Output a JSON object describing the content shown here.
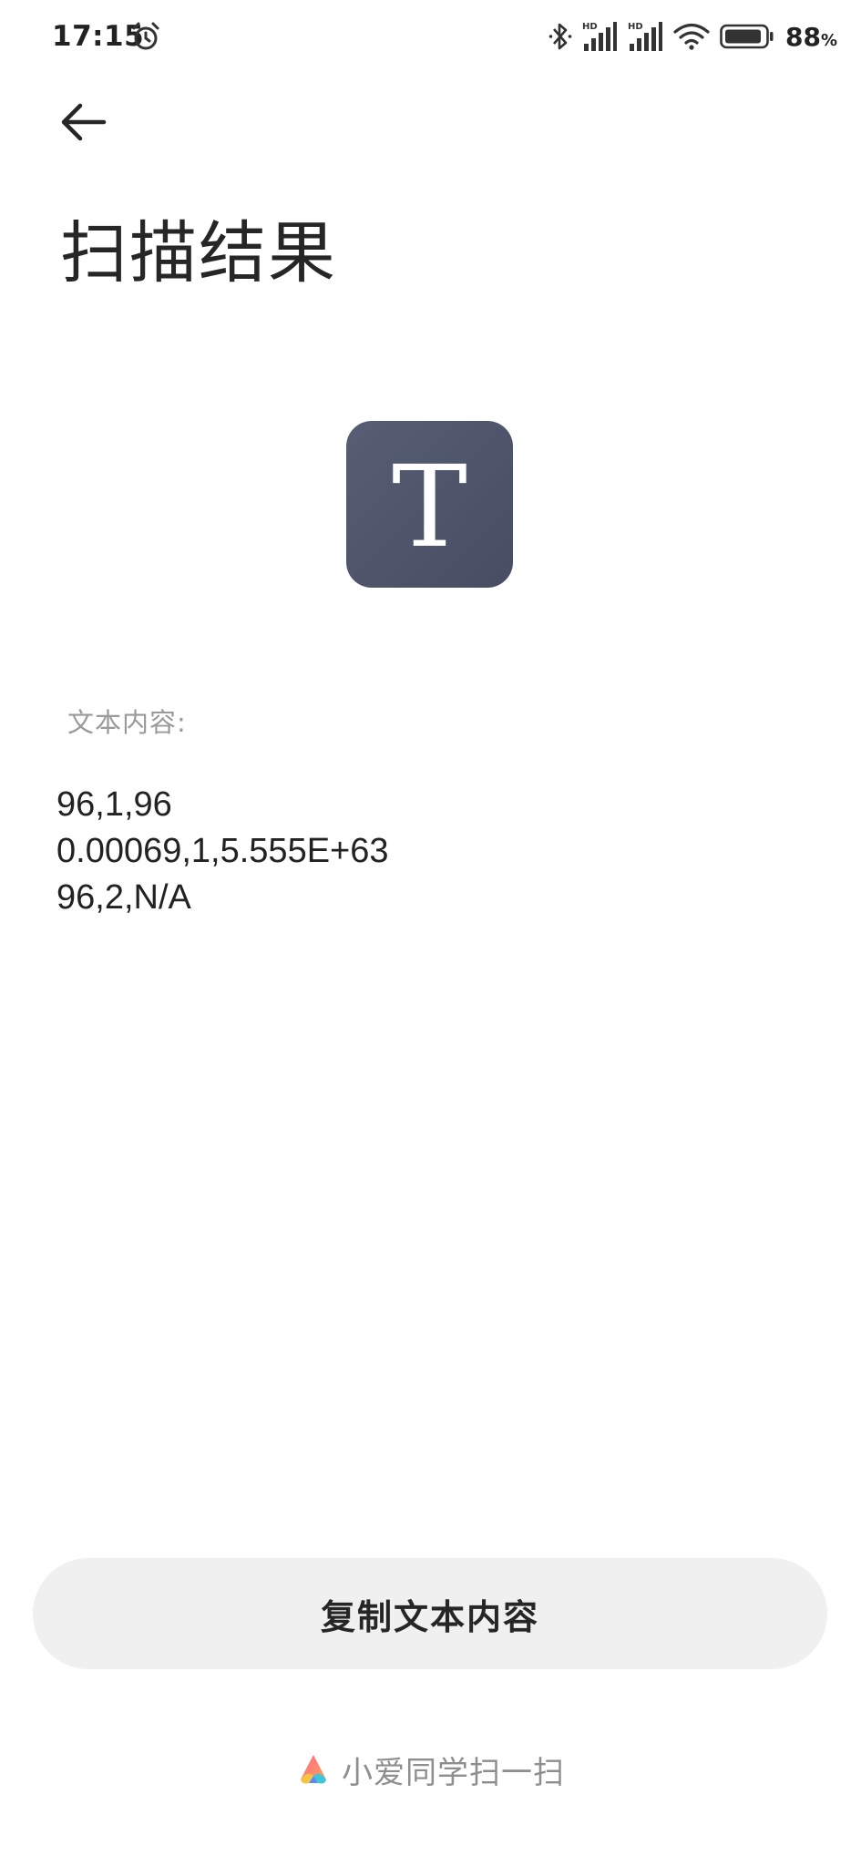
{
  "status_bar": {
    "time": "17:15",
    "battery_percent": "88",
    "battery_unit": "%",
    "icons": [
      "alarm-icon",
      "bluetooth-icon",
      "signal-hd-icon",
      "signal-hd-icon",
      "wifi-icon",
      "battery-icon"
    ]
  },
  "header": {
    "back_icon": "arrow-left-icon",
    "title": "扫描结果"
  },
  "result": {
    "type_icon_letter": "T",
    "type_icon_color": "#50566b",
    "label": "文本内容:",
    "lines": [
      "96,1,96",
      "0.00069,1,5.555E+63",
      "96,2,N/A"
    ]
  },
  "actions": {
    "copy_label": "复制文本内容"
  },
  "footer": {
    "logo_icon": "xiaoai-logo-icon",
    "text": "小爱同学扫一扫"
  }
}
